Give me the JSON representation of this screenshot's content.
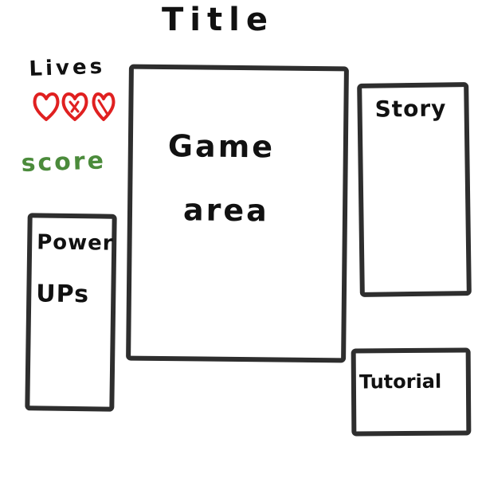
{
  "header": {
    "title": "Title"
  },
  "hud": {
    "lives_label": "Lives",
    "lives_count": 3,
    "score_label": "score"
  },
  "panels": {
    "game_area": {
      "line1": "Game",
      "line2": "area"
    },
    "story": {
      "label": "Story"
    },
    "power_ups": {
      "line1": "Power",
      "line2": "UPs"
    },
    "tutorial": {
      "label": "Tutorial"
    }
  },
  "colors": {
    "ink": "#2e2e2e",
    "heart": "#e02020",
    "score": "#4b8b3b",
    "background": "#ffffff"
  },
  "icons": {
    "lives": "heart-icon"
  }
}
